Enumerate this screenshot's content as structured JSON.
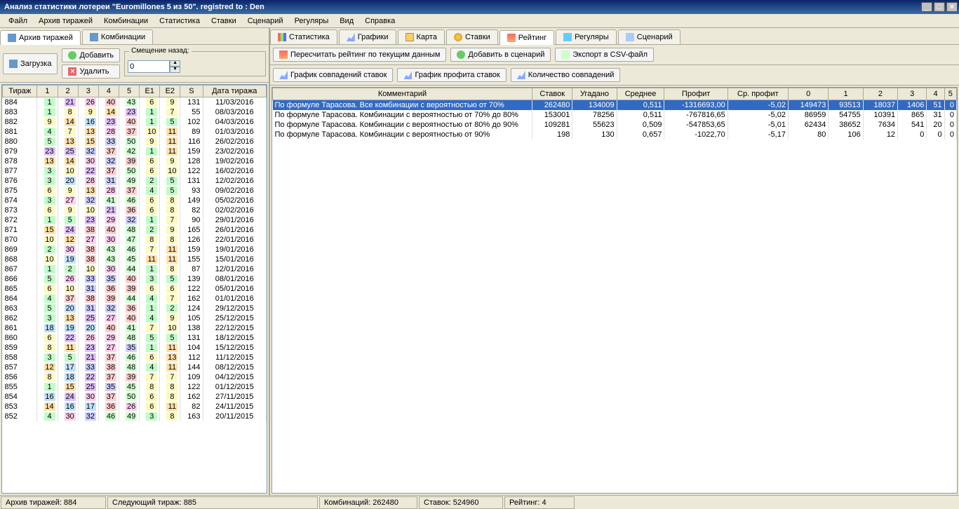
{
  "titlebar": "Анализ статистики лотереи \"Euromillones 5 из 50\". registred to : Den",
  "menu": [
    "Файл",
    "Архив тиражей",
    "Комбинации",
    "Статистика",
    "Ставки",
    "Сценарий",
    "Регуляры",
    "Вид",
    "Справка"
  ],
  "left": {
    "tabs": [
      "Архив тиражей",
      "Комбинации"
    ],
    "activeTab": 0,
    "btn_load": "Загрузка",
    "btn_add": "Добавить",
    "btn_del": "Удалить",
    "offset_label": "Смещение назад:",
    "offset_value": "0",
    "headers": [
      "Тираж",
      "1",
      "2",
      "3",
      "4",
      "5",
      "E1",
      "E2",
      "S",
      "Дата тиража"
    ],
    "rows": [
      [
        "884",
        1,
        21,
        26,
        40,
        43,
        6,
        9,
        131,
        "11/03/2016"
      ],
      [
        "883",
        1,
        8,
        9,
        14,
        23,
        1,
        7,
        55,
        "08/03/2016"
      ],
      [
        "882",
        9,
        14,
        16,
        23,
        40,
        1,
        5,
        102,
        "04/03/2016"
      ],
      [
        "881",
        4,
        7,
        13,
        28,
        37,
        10,
        11,
        89,
        "01/03/2016"
      ],
      [
        "880",
        5,
        13,
        15,
        33,
        50,
        9,
        11,
        116,
        "26/02/2016"
      ],
      [
        "879",
        23,
        25,
        32,
        37,
        42,
        1,
        11,
        159,
        "23/02/2016"
      ],
      [
        "878",
        13,
        14,
        30,
        32,
        39,
        6,
        9,
        128,
        "19/02/2016"
      ],
      [
        "877",
        3,
        10,
        22,
        37,
        50,
        6,
        10,
        122,
        "16/02/2016"
      ],
      [
        "876",
        3,
        20,
        28,
        31,
        49,
        2,
        5,
        131,
        "12/02/2016"
      ],
      [
        "875",
        6,
        9,
        13,
        28,
        37,
        4,
        5,
        93,
        "09/02/2016"
      ],
      [
        "874",
        3,
        27,
        32,
        41,
        46,
        6,
        8,
        149,
        "05/02/2016"
      ],
      [
        "873",
        6,
        9,
        10,
        21,
        36,
        6,
        8,
        82,
        "02/02/2016"
      ],
      [
        "872",
        1,
        5,
        23,
        29,
        32,
        1,
        7,
        90,
        "29/01/2016"
      ],
      [
        "871",
        15,
        24,
        38,
        40,
        48,
        2,
        9,
        165,
        "26/01/2016"
      ],
      [
        "870",
        10,
        12,
        27,
        30,
        47,
        8,
        8,
        126,
        "22/01/2016"
      ],
      [
        "869",
        2,
        30,
        38,
        43,
        46,
        7,
        11,
        159,
        "19/01/2016"
      ],
      [
        "868",
        10,
        19,
        38,
        43,
        45,
        11,
        11,
        155,
        "15/01/2016"
      ],
      [
        "867",
        1,
        2,
        10,
        30,
        44,
        1,
        8,
        87,
        "12/01/2016"
      ],
      [
        "866",
        5,
        26,
        33,
        35,
        40,
        3,
        5,
        139,
        "08/01/2016"
      ],
      [
        "865",
        6,
        10,
        31,
        36,
        39,
        6,
        6,
        122,
        "05/01/2016"
      ],
      [
        "864",
        4,
        37,
        38,
        39,
        44,
        4,
        7,
        162,
        "01/01/2016"
      ],
      [
        "863",
        5,
        20,
        31,
        32,
        36,
        1,
        2,
        124,
        "29/12/2015"
      ],
      [
        "862",
        3,
        13,
        25,
        27,
        40,
        4,
        9,
        105,
        "25/12/2015"
      ],
      [
        "861",
        18,
        19,
        20,
        40,
        41,
        7,
        10,
        138,
        "22/12/2015"
      ],
      [
        "860",
        6,
        22,
        26,
        29,
        48,
        5,
        5,
        131,
        "18/12/2015"
      ],
      [
        "859",
        8,
        11,
        23,
        27,
        35,
        1,
        11,
        104,
        "15/12/2015"
      ],
      [
        "858",
        3,
        5,
        21,
        37,
        46,
        6,
        13,
        112,
        "11/12/2015"
      ],
      [
        "857",
        12,
        17,
        33,
        38,
        48,
        4,
        11,
        144,
        "08/12/2015"
      ],
      [
        "856",
        8,
        18,
        22,
        37,
        39,
        7,
        7,
        109,
        "04/12/2015"
      ],
      [
        "855",
        1,
        15,
        25,
        35,
        45,
        8,
        8,
        122,
        "01/12/2015"
      ],
      [
        "854",
        16,
        24,
        30,
        37,
        50,
        6,
        8,
        162,
        "27/11/2015"
      ],
      [
        "853",
        14,
        16,
        17,
        36,
        26,
        6,
        11,
        82,
        "24/11/2015"
      ],
      [
        "852",
        4,
        30,
        32,
        46,
        49,
        3,
        8,
        163,
        "20/11/2015"
      ]
    ]
  },
  "right": {
    "tabs": [
      "Статистика",
      "Графики",
      "Карта",
      "Ставки",
      "Рейтинг",
      "Регуляры",
      "Сценарий"
    ],
    "activeTab": 4,
    "toolbar1": [
      "Пересчитать рейтинг по текущим данным",
      "Добавить в сценарий",
      "Экспорт в CSV-файл"
    ],
    "toolbar2": [
      "График совпадений ставок",
      "График профита ставок",
      "Количество совпадений"
    ],
    "headers": [
      "Комментарий",
      "Ставок",
      "Угадано",
      "Среднее",
      "Профит",
      "Ср. профит",
      "0",
      "1",
      "2",
      "3",
      "4",
      "5"
    ],
    "rows": [
      [
        "По формуле Тарасова. Все комбинации с вероятностью от 70%",
        "262480",
        "134009",
        "0,511",
        "-1316693,00",
        "-5,02",
        "149473",
        "93513",
        "18037",
        "1406",
        "51",
        "0"
      ],
      [
        "По формуле Тарасова. Комбинации с вероятностью от 70% до 80%",
        "153001",
        "78256",
        "0,511",
        "-767816,65",
        "-5,02",
        "86959",
        "54755",
        "10391",
        "865",
        "31",
        "0"
      ],
      [
        "По формуле Тарасова. Комбинации с вероятностью от 80% до 90%",
        "109281",
        "55623",
        "0,509",
        "-547853,65",
        "-5,01",
        "62434",
        "38652",
        "7634",
        "541",
        "20",
        "0"
      ],
      [
        "По формуле Тарасова. Комбинации с вероятностью от 90%",
        "198",
        "130",
        "0,657",
        "-1022,70",
        "-5,17",
        "80",
        "106",
        "12",
        "0",
        "0",
        "0"
      ]
    ],
    "selected": 0
  },
  "status": {
    "archive": "Архив тиражей: 884",
    "next": "Следующий тираж: 885",
    "combos": "Комбинаций: 262480",
    "bets": "Ставок: 524960",
    "rating": "Рейтинг: 4"
  }
}
